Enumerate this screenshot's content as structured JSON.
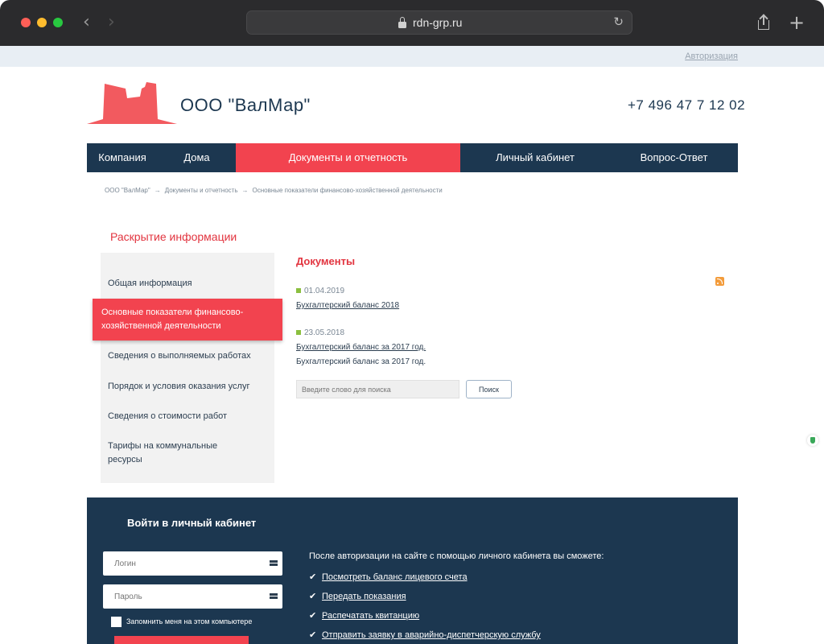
{
  "browser": {
    "url": "rdn-grp.ru"
  },
  "header": {
    "auth_link": "Авторизация",
    "company_name": "ООО \"ВалМар\"",
    "phone": "+7 496 47 7 12 02",
    "logo_color": "#f25a5f"
  },
  "nav": {
    "items": [
      "Компания",
      "Дома",
      "Документы и отчетность",
      "Личный кабинет",
      "Вопрос-Ответ"
    ],
    "active_index": 2
  },
  "breadcrumb": {
    "items": [
      "ООО \"ВалМар\"",
      "Документы и отчетность",
      "Основные показатели финансово-хозяйственной деятельности"
    ],
    "separator": "→"
  },
  "sidebar": {
    "title": "Раскрытие информации",
    "items": [
      "Общая информация",
      "Основные показатели финансово-хозяйственной деятельности",
      "Сведения о выполняемых работах",
      "Порядок и условия оказания услуг",
      "Сведения о стоимости работ",
      "Тарифы на коммунальные ресурсы"
    ],
    "active_index": 1
  },
  "documents": {
    "title": "Документы",
    "entries": [
      {
        "date": "01.04.2019",
        "links": [
          "Бухгалтерский баланс 2018"
        ]
      },
      {
        "date": "23.05.2018",
        "links": [
          "Бухгалтерский баланс за 2017 год.",
          "Бухгалтерский баланс за 2017 год."
        ]
      }
    ],
    "search_placeholder": "Введите слово для поиска",
    "search_button": "Поиск"
  },
  "login": {
    "title": "Войти в личный кабинет",
    "login_placeholder": "Логин",
    "password_placeholder": "Пароль",
    "remember_label": "Запомнить меня на этом компьютере",
    "after_text": "После авторизации на сайте с помощью личного кабинета вы сможете:",
    "features": [
      "Посмотреть баланс лицевого счета",
      "Передать показания",
      "Распечатать квитанцию",
      "Отправить заявку в аварийно-диспетчерскую службу"
    ]
  },
  "colors": {
    "navy": "#1c3750",
    "accent_red": "#f2434f",
    "sidebar_bg": "#f2f2f2"
  }
}
